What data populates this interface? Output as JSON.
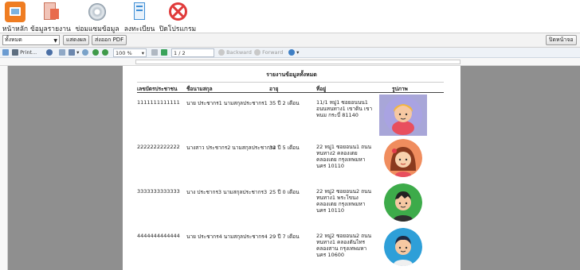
{
  "toolbar": {
    "items": [
      {
        "label": "หน้าหลัก",
        "icon": "home-icon",
        "color": "#ef7d22"
      },
      {
        "label": "ข้อมูลรายงาน",
        "icon": "report-icon",
        "color": "#e86b4d"
      },
      {
        "label": "ข่อมแซมข้อมูล",
        "icon": "repair-disc-icon",
        "color": "#7a8a99"
      },
      {
        "label": "ลงทะเบียน",
        "icon": "register-icon",
        "color": "#3f8fd6"
      },
      {
        "label": "ปิดโปรแกรม",
        "icon": "close-program-icon",
        "color": "#e03a3a"
      }
    ]
  },
  "filter": {
    "selected": "ทั้งหมด",
    "show_label": "แสดงผล",
    "export_label": "ส่งออก PDF",
    "close_window_label": "ปิดหน้าจอ"
  },
  "viewer": {
    "print_label": "Print...",
    "zoom": "100 %",
    "page": "1 / 2",
    "backward_label": "Backward",
    "forward_label": "Forward"
  },
  "report": {
    "title": "รายงานข้อมูลทั้งหมด",
    "headers": [
      "เลขบัตรประชาชน",
      "ชื่อนามสกุล",
      "อายุ",
      "ที่อยู่",
      "รูปภาพ"
    ],
    "rows": [
      {
        "id": "1111111111111",
        "name": "นาย ประชากร1  นามสกุลประชากร1",
        "age": "35 ปี 2 เดือน",
        "address": "11/1  หมู่1  ซอยอนนน1 อนนหนทาง1  เขาดิน  เขา พนม  กระบี่  81140",
        "avatar": "blonde-person-avatar"
      },
      {
        "id": "2222222222222",
        "name": "นางสาว ประชากร2  นามสกุลประชากร2",
        "age": "34 ปี 5 เดือน",
        "address": "22  หมู่1  ซอยอนน1  ถนน หนทาง2  คลองเตย คลองเตย  กรุงเทพมหา นคร  10110",
        "avatar": "girl-avatar"
      },
      {
        "id": "3333333333333",
        "name": "นาง ประชากร3  นามสกุลประชากร3",
        "age": "25 ปี 0 เดือน",
        "address": "22  หมู่2  ซอยอนน2  ถนน หนทาง1  พระโขนง คลองเตย  กรุงเทพมหา นคร  10110",
        "avatar": "boy-avatar"
      },
      {
        "id": "4444444444444",
        "name": "นาย ประชากร4  นามสกุลประชากร4",
        "age": "29 ปี 7 เดือน",
        "address": "22  หมู่2  ซอยอนน2  ถนน หนทาง1  คลองตันไทร คลองสาน  กรุงเทพมหา นคร  10600",
        "avatar": "man-avatar"
      }
    ]
  }
}
